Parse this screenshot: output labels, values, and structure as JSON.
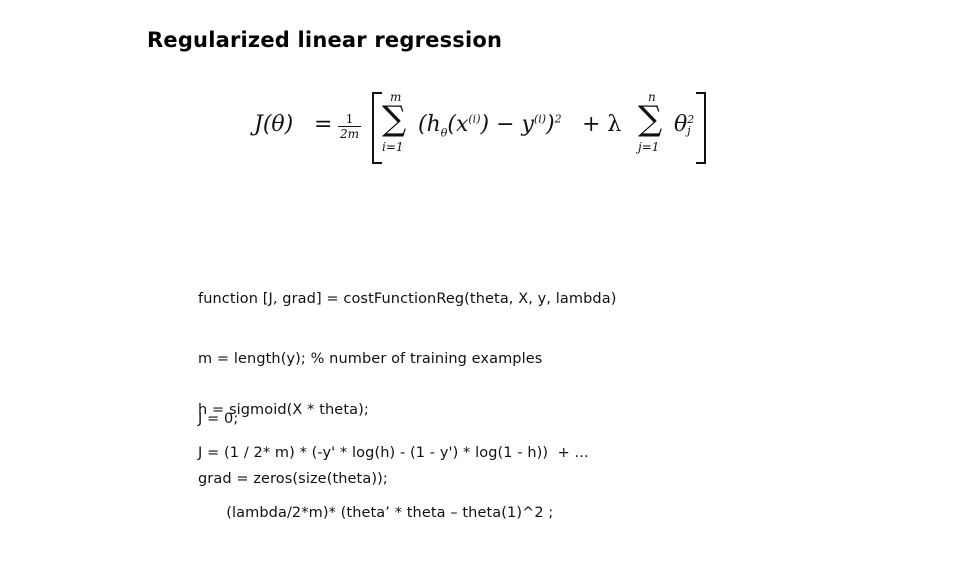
{
  "slide": {
    "title": "Regularized linear regression"
  },
  "equation": {
    "lhs": "J(θ)",
    "equals": "=",
    "frac_num": "1",
    "frac_den": "2m",
    "sum1_upper": "m",
    "sum1_lower": "i=1",
    "sum_symbol": "∑",
    "term1": "(h",
    "term1_sub": "θ",
    "term1_rest": "(x",
    "term1_sup": "(i)",
    "term1_close": ") − y",
    "term2_sup": "(i)",
    "term2_close": ")",
    "square": "2",
    "plus_lambda": "+ λ",
    "sum2_upper": "n",
    "sum2_lower": "j=1",
    "theta": "θ",
    "theta_sup": "2",
    "theta_sub": "j",
    "latex": "J(\\theta) = \\frac{1}{2m}\\left[\\sum_{i=1}^{m}(h_\\theta(x^{(i)}) - y^{(i)})^2 + \\lambda\\sum_{j=1}^{n}\\theta_j^2\\right]"
  },
  "code": {
    "block1": [
      "function [J, grad] = costFunctionReg(theta, X, y, lambda)",
      "m = length(y); % number of training examples",
      "J = 0;",
      "grad = zeros(size(theta));"
    ],
    "block2": [
      "h = sigmoid(X * theta);"
    ],
    "block3": [
      "J = (1 / 2* m) * (-y' * log(h) - (1 - y') * log(1 - h))  + ...",
      "      (lambda/2*m)* (theta’ * theta – theta(1)^2 ;"
    ]
  }
}
